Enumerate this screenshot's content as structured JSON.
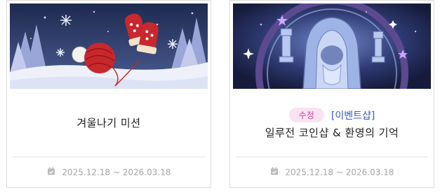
{
  "cards": [
    {
      "title": "겨울나기 미션",
      "date_range": "2025.12.18 ~ 2026.03.18",
      "icons": [
        "calendar-check-icon"
      ]
    },
    {
      "badge": "수정",
      "category": "[이벤트샵]",
      "title": "일루전 코인샵 & 환영의 기억",
      "date_range": "2025.12.18 ~ 2026.03.18",
      "icons": [
        "calendar-check-icon"
      ]
    }
  ],
  "colors": {
    "badge_bg": "#f9e3f1",
    "badge_text": "#d5489a",
    "category_text": "#3b58c6",
    "date_text": "#a6a6a6"
  }
}
